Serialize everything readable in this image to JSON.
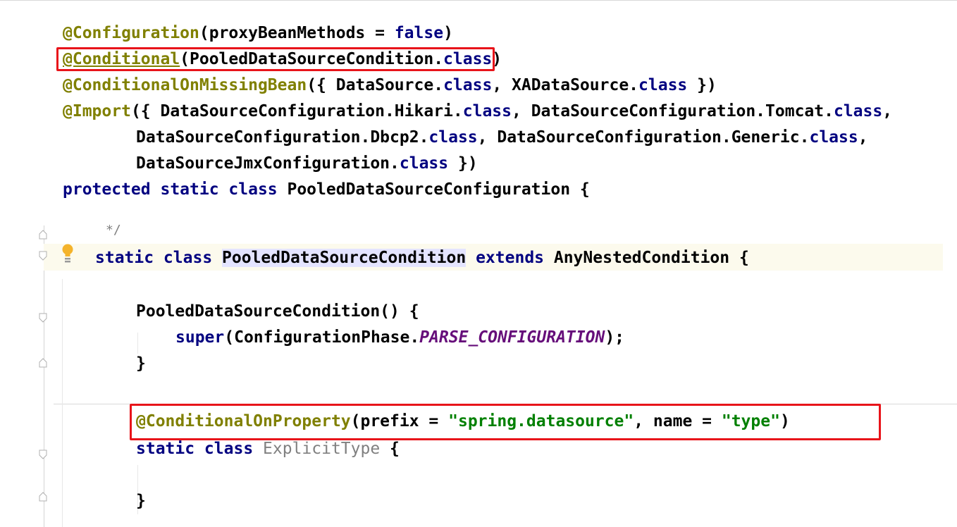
{
  "colors": {
    "annotation": "#808000",
    "keyword": "#000080",
    "string": "#008000",
    "constant": "#660e7a",
    "highlight_box": "#e8141a",
    "caret_row": "#fcfaed",
    "identifier_highlight": "#e4e4ff"
  },
  "code": {
    "l1": {
      "ann": "@Configuration",
      "a": "(proxyBeanMethods = ",
      "kw": "false",
      "b": ")"
    },
    "l2": {
      "ann": "@Conditional",
      "a": "(PooledDataSourceCondition.",
      "kw": "class",
      "b": ")"
    },
    "l3": {
      "ann": "@ConditionalOnMissingBean",
      "a": "({ DataSource.",
      "kw1": "class",
      "b": ", XADataSource.",
      "kw2": "class",
      "c": " })"
    },
    "l4": {
      "ann": "@Import",
      "a": "({ DataSourceConfiguration.Hikari.",
      "kw1": "class",
      "b": ", DataSourceConfiguration.Tomcat.",
      "kw2": "class",
      "c": ","
    },
    "l5": {
      "a": "DataSourceConfiguration.Dbcp2.",
      "kw1": "class",
      "b": ", DataSourceConfiguration.Generic.",
      "kw2": "class",
      "c": ","
    },
    "l6": {
      "a": "DataSourceJmxConfiguration.",
      "kw": "class",
      "b": " })"
    },
    "l7": {
      "kw": "protected static class",
      "a": " PooledDataSourceConfiguration {"
    },
    "l8": {
      "comment": "*/"
    },
    "l9": {
      "kw1": "static class",
      "name": "PooledDataSourceCondition",
      "kw2": "extends",
      "a": " AnyNestedCondition {"
    },
    "l10": {
      "a": "PooledDataSourceCondition() {"
    },
    "l11": {
      "kw": "super",
      "a": "(ConfigurationPhase.",
      "const": "PARSE_CONFIGURATION",
      "b": ");"
    },
    "l12": {
      "a": "}"
    },
    "l13": {
      "ann": "@ConditionalOnProperty",
      "a": "(prefix = ",
      "s1": "\"spring.datasource\"",
      "b": ", name = ",
      "s2": "\"type\"",
      "c": ")"
    },
    "l14": {
      "kw": "static class",
      "name": "ExplicitType",
      "a": " {"
    },
    "l15": {
      "a": "}"
    }
  }
}
